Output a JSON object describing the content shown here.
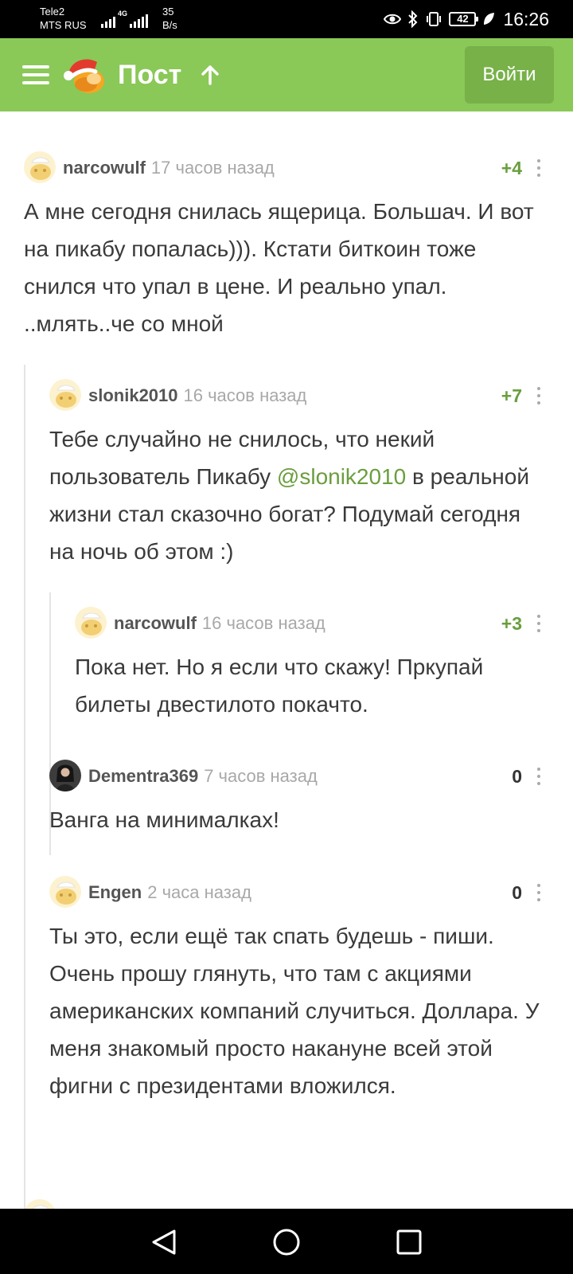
{
  "status_bar": {
    "carrier1": "Tele2",
    "carrier2": "MTS RUS",
    "net_type": "4G",
    "speed_value": "35",
    "speed_unit": "B/s",
    "battery": "42",
    "time": "16:26"
  },
  "header": {
    "title": "Пост",
    "login_label": "Войти",
    "accent_color": "#8ac858"
  },
  "comments": [
    {
      "username": "narcowulf",
      "time": "17 часов назад",
      "rating": "+4",
      "text": "А мне сегодня снилась ящерица. Большач. И вот на пикабу попалась))). Кстати биткоин тоже снился что упал в цене. И реально упал. ..млять..че со мной"
    },
    {
      "username": "slonik2010",
      "time": "16 часов назад",
      "rating": "+7",
      "text_before": "Тебе случайно не снилось, что некий пользователь Пикабу ",
      "mention": "@slonik2010",
      "text_after": " в реальной жизни стал сказочно богат? Подумай сегодня на ночь об этом :)"
    },
    {
      "username": "narcowulf",
      "time": "16 часов назад",
      "rating": "+3",
      "text": "Пока нет. Но я если что скажу! Пркупай билеты двестилото покачто."
    },
    {
      "username": "Dementra369",
      "time": "7 часов назад",
      "rating": "0",
      "text": "Ванга на минималках!"
    },
    {
      "username": "Engen",
      "time": "2 часа назад",
      "rating": "0",
      "text": "Ты это, если ещё так спать будешь - пиши. Очень прошу глянуть, что там с акциями американских компаний случиться. Доллара. У меня знакомый просто накануне всей этой фигни с президентами вложился."
    }
  ]
}
